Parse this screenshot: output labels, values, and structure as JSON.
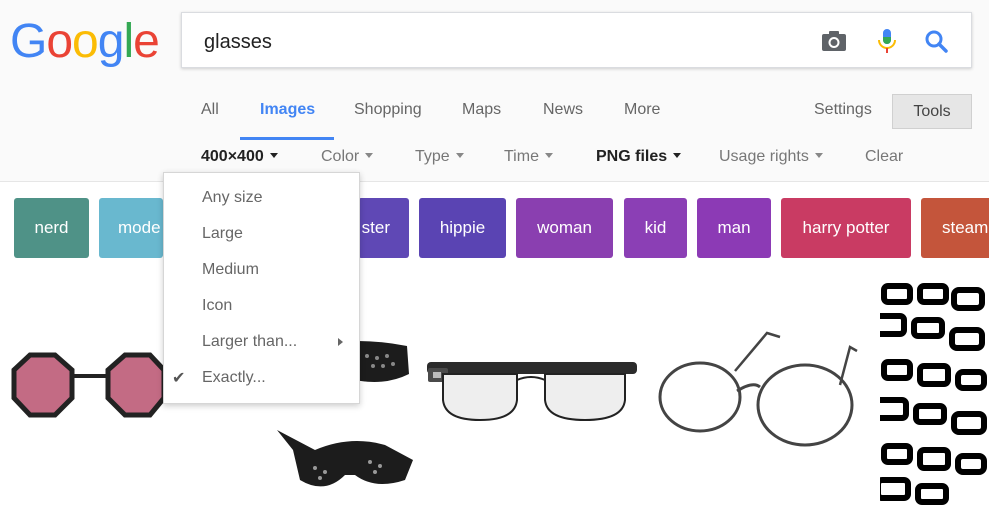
{
  "logo": {
    "letters": [
      "G",
      "o",
      "o",
      "g",
      "l",
      "e"
    ]
  },
  "search": {
    "value": "glasses"
  },
  "nav": {
    "tabs": [
      "All",
      "Images",
      "Shopping",
      "Maps",
      "News",
      "More"
    ],
    "settings": "Settings",
    "tools": "Tools"
  },
  "filters": {
    "size": "400×400",
    "color": "Color",
    "type": "Type",
    "time": "Time",
    "png": "PNG files",
    "usage": "Usage rights",
    "clear": "Clear"
  },
  "chips": [
    {
      "label": "nerd",
      "color": "#4f9287"
    },
    {
      "label": "mode",
      "color": "#69b8cf"
    },
    {
      "label": "ster",
      "color": "#5f48b5"
    },
    {
      "label": "hippie",
      "color": "#5a44b3"
    },
    {
      "label": "woman",
      "color": "#8a3fb0"
    },
    {
      "label": "kid",
      "color": "#8b3fb5"
    },
    {
      "label": "man",
      "color": "#8c3ab5"
    },
    {
      "label": "harry potter",
      "color": "#c93b63"
    },
    {
      "label": "steam",
      "color": "#c4553b"
    }
  ],
  "size_dropdown": {
    "items": [
      "Any size",
      "Large",
      "Medium",
      "Icon",
      "Larger than...",
      "Exactly..."
    ],
    "checked": "Exactly..."
  },
  "icons": {
    "camera": "camera-icon",
    "mic": "microphone-icon",
    "search": "search-icon"
  },
  "colors": {
    "accent": "#4285f4"
  }
}
